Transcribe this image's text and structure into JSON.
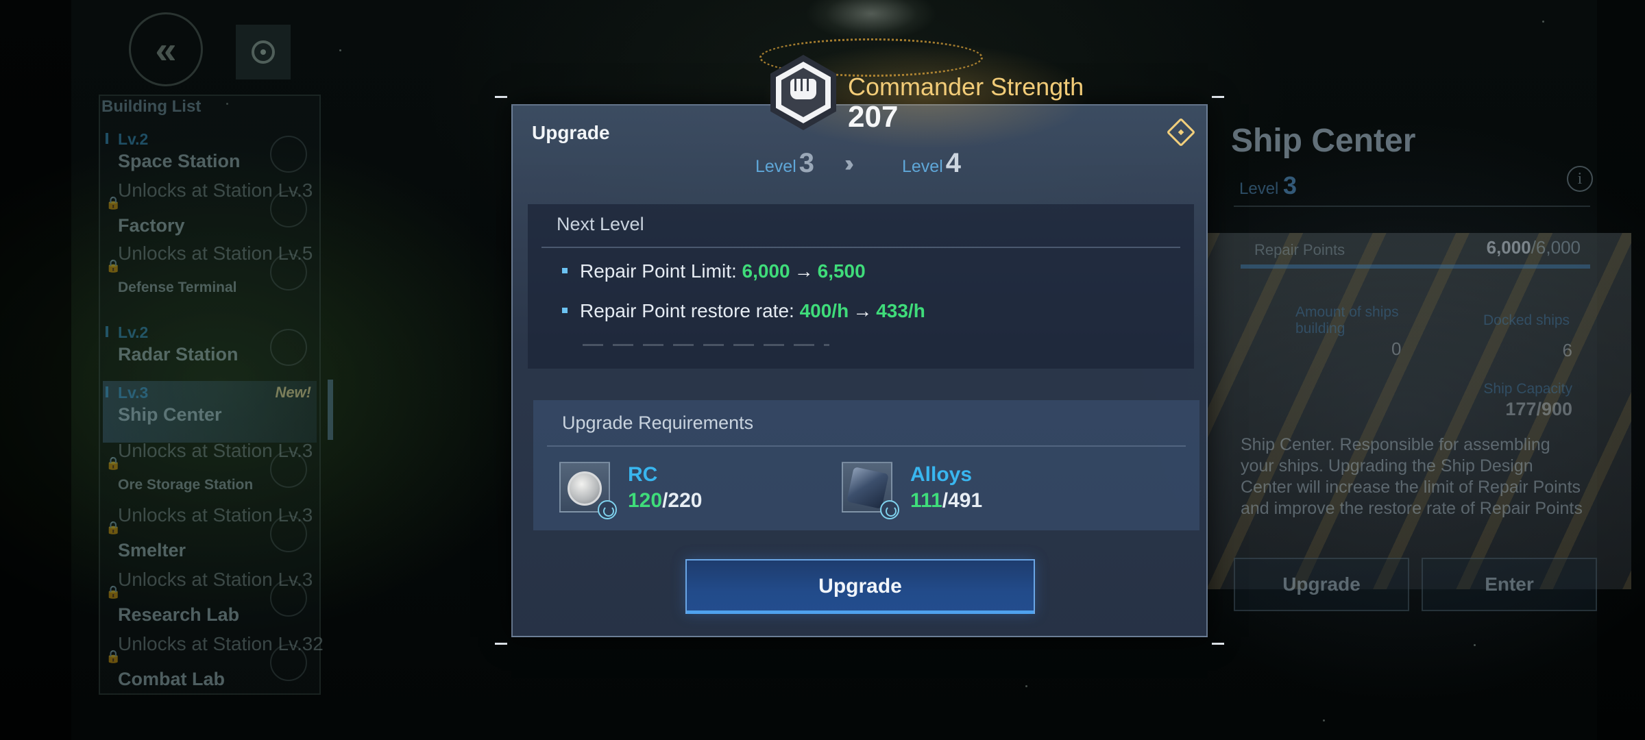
{
  "background": {
    "nav": {
      "back_icon": "double-chevron-left-icon",
      "target_icon": "target-icon"
    },
    "building_list": {
      "title": "Building List",
      "items": [
        {
          "level": "Lv.2",
          "name": "Space Station"
        },
        {
          "lock_text": "Unlocks at Station Lv.3",
          "name": "Factory"
        },
        {
          "lock_text": "Unlocks at Station Lv.5",
          "name": "Defense Terminal"
        },
        {
          "level": "Lv.2",
          "name": "Radar Station"
        },
        {
          "level": "Lv.3",
          "name": "Ship Center",
          "badge": "New!"
        },
        {
          "lock_text": "Unlocks at Station Lv.3",
          "name": "Ore Storage Station"
        },
        {
          "lock_text": "Unlocks at Station Lv.3",
          "name": "Smelter"
        },
        {
          "lock_text": "Unlocks at Station Lv.3",
          "name": "Research Lab"
        },
        {
          "lock_text": "Unlocks at Station Lv.32",
          "name": "Combat Lab"
        }
      ]
    },
    "ship_center": {
      "title": "Ship Center",
      "level_label": "Level",
      "level_value": "3",
      "repair_label": "Repair Points",
      "repair_current": "6,000",
      "repair_max": "/6,000",
      "stat_left_label": "Amount of ships building",
      "stat_left_value": "0",
      "stat_right_label": "Docked ships",
      "stat_right_value": "6",
      "capacity_label": "Ship Capacity",
      "capacity_value": "177/900",
      "description": "Ship Center. Responsible for assembling your ships. Upgrading the Ship Design Center will increase the limit of Repair Points and improve the restore rate of Repair Points",
      "upgrade_label": "Upgrade",
      "enter_label": "Enter"
    }
  },
  "commander": {
    "label": "Commander Strength",
    "value": "207",
    "icon": "fist-shield-icon"
  },
  "modal": {
    "title": "Upgrade",
    "close_icon": "diamond-close-icon",
    "level_from_label": "Level",
    "level_from": "3",
    "level_to_label": "Level",
    "level_to": "4",
    "next_level": {
      "title": "Next Level",
      "stats": [
        {
          "label": "Repair Point Limit: ",
          "from": "6,000",
          "arrow": "→",
          "to": "6,500"
        },
        {
          "label": "Repair Point restore rate: ",
          "from": "400/h",
          "arrow": "→",
          "to": "433/h"
        }
      ]
    },
    "requirements": {
      "title": "Upgrade Requirements",
      "items": [
        {
          "name": "RC",
          "have": "120",
          "need": "/220",
          "icon": "rc-coin-icon"
        },
        {
          "name": "Alloys",
          "have": "111",
          "need": "/491",
          "icon": "alloys-icon"
        }
      ]
    },
    "upgrade_button": "Upgrade"
  },
  "colors": {
    "accent_blue": "#39b6ef",
    "green_value": "#3fdc7a",
    "gold": "#f2cc78"
  }
}
